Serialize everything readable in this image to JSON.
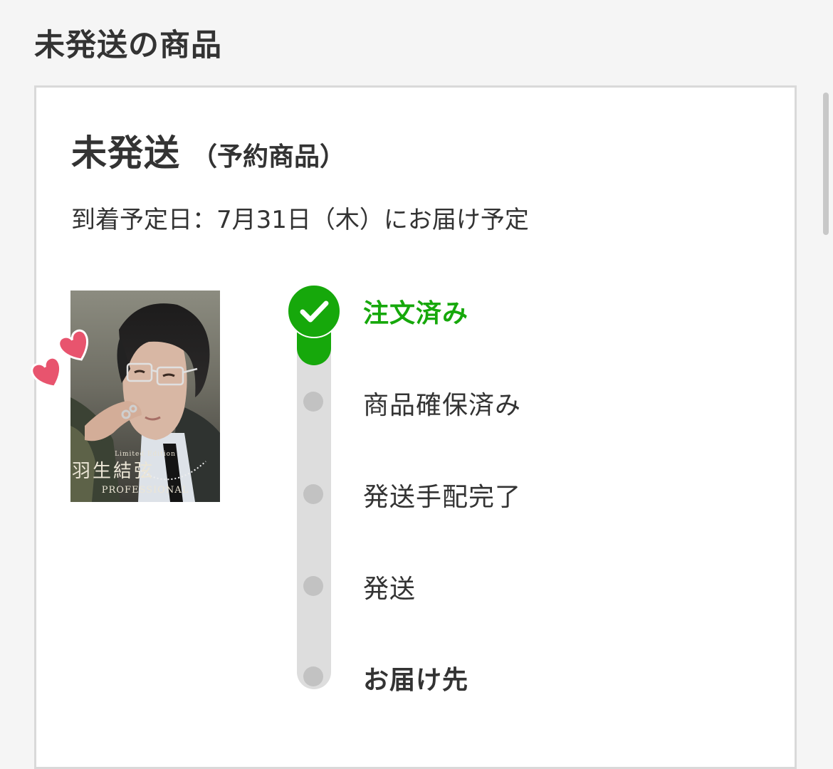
{
  "section": {
    "title": "未発送の商品"
  },
  "order": {
    "status": "未発送",
    "status_note": "（予約商品）",
    "arrival_text": "到着予定日：7月31日（木）にお届け予定",
    "cover_title": "羽生結弦",
    "cover_subtitle": "PROFESSIONAL",
    "cover_edition": "Limited Edition"
  },
  "progress": {
    "completed_steps": 1,
    "steps": [
      {
        "label": "注文済み",
        "state": "done"
      },
      {
        "label": "商品確保済み",
        "state": "pending"
      },
      {
        "label": "発送手配完了",
        "state": "pending"
      },
      {
        "label": "発送",
        "state": "pending"
      },
      {
        "label": "お届け先",
        "state": "pending"
      }
    ]
  },
  "colors": {
    "accent_green": "#16a80b",
    "track_gray": "#dddddd",
    "dot_gray": "#c2c2c2",
    "heart_pink": "#e8546e"
  },
  "icons": {
    "done_step": "checkmark-icon",
    "sticker": "hearts-icon"
  }
}
